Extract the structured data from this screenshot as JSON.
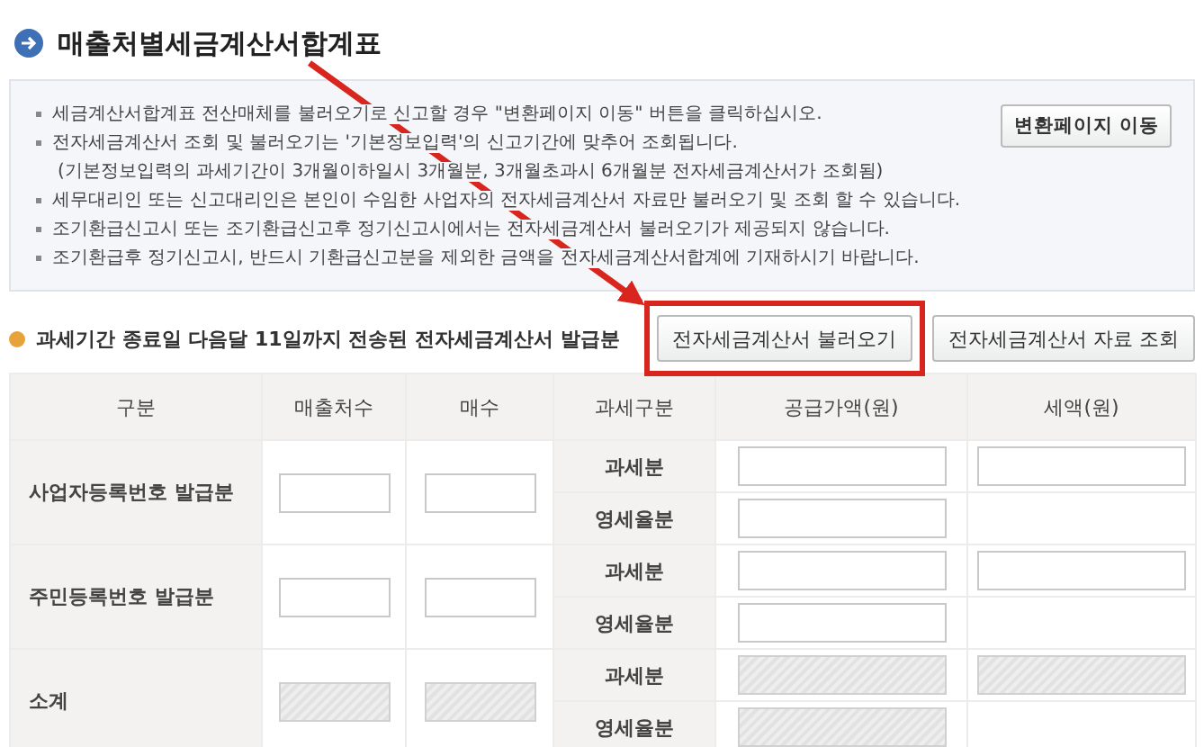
{
  "title": "매출처별세금계산서합계표",
  "notice": {
    "lines": [
      {
        "kind": "bullet",
        "text": "세금계산서합계표 전산매체를 불러오기로 신고할 경우 \"변환페이지 이동\" 버튼을 클릭하십시오."
      },
      {
        "kind": "bullet",
        "text": "전자세금계산서 조회 및 불러오기는 '기본정보입력'의 신고기간에 맞추어 조회됩니다."
      },
      {
        "kind": "note",
        "text": "(기본정보입력의 과세기간이 3개월이하일시 3개월분, 3개월초과시 6개월분 전자세금계산서가 조회됨)"
      },
      {
        "kind": "bullet",
        "text": "세무대리인 또는 신고대리인은 본인이 수임한 사업자의 전자세금계산서 자료만 불러오기 및 조회 할 수 있습니다."
      },
      {
        "kind": "bullet",
        "text": "조기환급신고시 또는 조기환급신고후 정기신고시에서는 전자세금계산서 불러오기가 제공되지 않습니다."
      },
      {
        "kind": "bullet",
        "text": "조기환급후 정기신고시, 반드시 기환급신고분을 제외한 금액을 전자세금계산서합계에 기재하시기 바랍니다."
      }
    ],
    "button": "변환페이지 이동"
  },
  "section": {
    "title": "과세기간 종료일 다음달 11일까지 전송된 전자세금계산서 발급분",
    "buttons": [
      {
        "label": "전자세금계산서 불러오기",
        "highlighted": true
      },
      {
        "label": "전자세금계산서 자료 조회",
        "highlighted": false
      }
    ]
  },
  "table": {
    "columns": [
      "구분",
      "매출처수",
      "매수",
      "과세구분",
      "공급가액(원)",
      "세액(원)"
    ],
    "rows": [
      {
        "label": "사업자등록번호 발급분",
        "disabled": false,
        "subs": [
          {
            "label": "과세분",
            "kind": "taxable"
          },
          {
            "label": "영세율분",
            "kind": "zero"
          }
        ]
      },
      {
        "label": "주민등록번호 발급분",
        "disabled": false,
        "subs": [
          {
            "label": "과세분",
            "kind": "taxable"
          },
          {
            "label": "영세율분",
            "kind": "zero"
          }
        ]
      },
      {
        "label": "소계",
        "disabled": true,
        "subs": [
          {
            "label": "과세분",
            "kind": "taxable"
          },
          {
            "label": "영세율분",
            "kind": "zero"
          }
        ]
      }
    ]
  }
}
